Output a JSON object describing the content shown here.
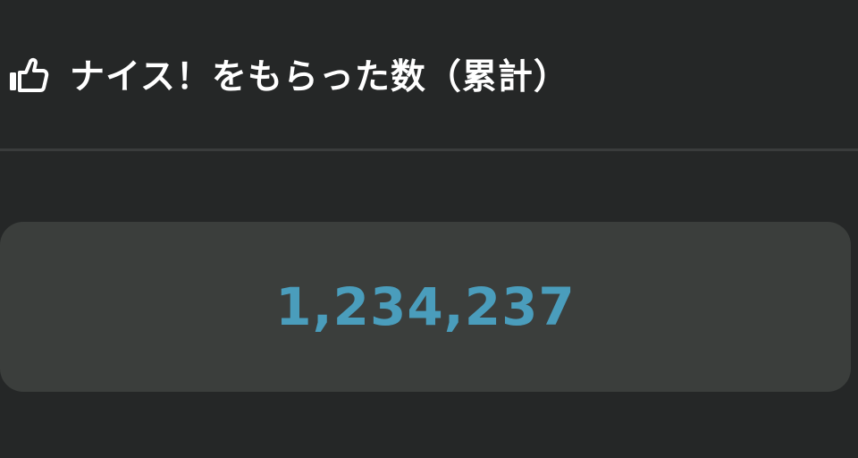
{
  "header": {
    "icon": "thumbs-up-icon",
    "title": "ナイス！をもらった数（累計）"
  },
  "stats": {
    "total_nice_count": "1,234,237"
  },
  "colors": {
    "background": "#252727",
    "card": "#3b3e3c",
    "accent": "#4a9dbc",
    "title_text": "#ffffff"
  }
}
